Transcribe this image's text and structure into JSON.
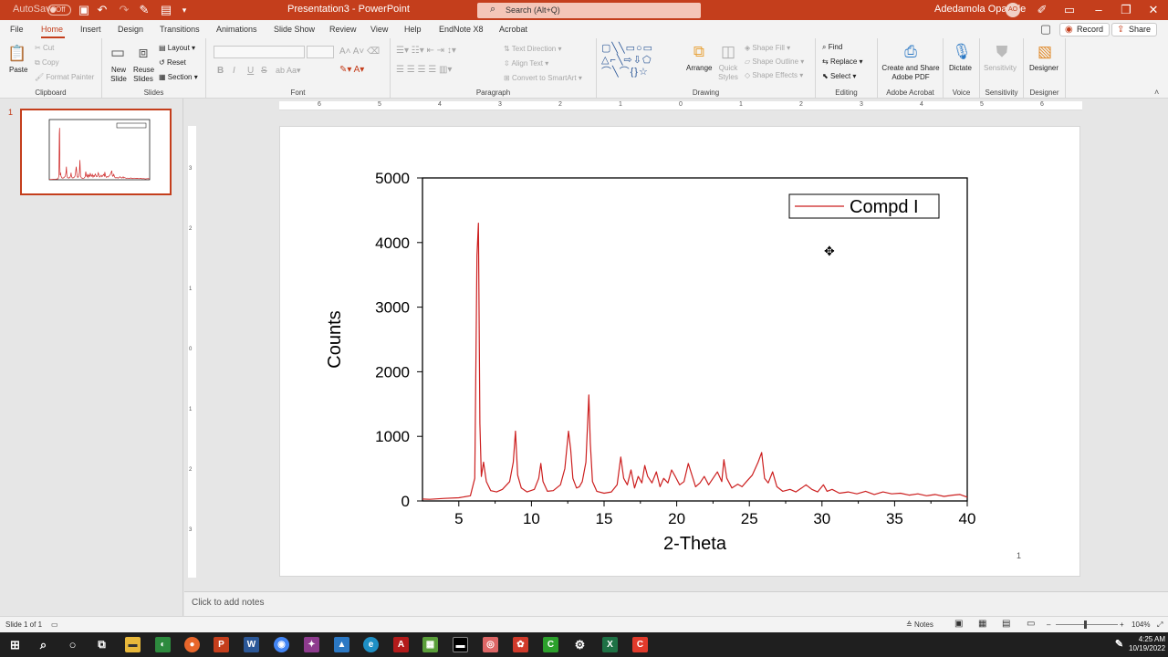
{
  "titlebar": {
    "autosave_label": "AutoSave",
    "autosave_state": "Off",
    "title": "Presentation3  -  PowerPoint",
    "search_placeholder": "Search (Alt+Q)",
    "user_name": "Adedamola Opalade",
    "user_initials": "AO"
  },
  "tabs": [
    "File",
    "Home",
    "Insert",
    "Design",
    "Transitions",
    "Animations",
    "Slide Show",
    "Review",
    "View",
    "Help",
    "EndNote X8",
    "Acrobat"
  ],
  "tab_right": {
    "record": "Record",
    "share": "Share"
  },
  "ribbon": {
    "clipboard": {
      "paste": "Paste",
      "cut": "Cut",
      "copy": "Copy",
      "format_painter": "Format Painter",
      "label": "Clipboard"
    },
    "slides": {
      "new_slide": "New Slide",
      "reuse_slides": "Reuse Slides",
      "layout": "Layout",
      "reset": "Reset",
      "section": "Section",
      "label": "Slides"
    },
    "font": {
      "label": "Font",
      "bold": "B",
      "italic": "I",
      "underline": "U",
      "strike": "S"
    },
    "paragraph": {
      "text_direction": "Text Direction",
      "align_text": "Align Text",
      "convert_smartart": "Convert to SmartArt",
      "label": "Paragraph"
    },
    "drawing": {
      "arrange": "Arrange",
      "quick_styles": "Quick Styles",
      "shape_fill": "Shape Fill",
      "shape_outline": "Shape Outline",
      "shape_effects": "Shape Effects",
      "label": "Drawing"
    },
    "editing": {
      "find": "Find",
      "replace": "Replace",
      "select": "Select",
      "label": "Editing"
    },
    "acrobat": {
      "create_share": "Create and Share Adobe PDF",
      "label": "Adobe Acrobat"
    },
    "voice": {
      "dictate": "Dictate",
      "label": "Voice"
    },
    "sensitivity": {
      "sensitivity": "Sensitivity",
      "label": "Sensitivity"
    },
    "designer": {
      "designer": "Designer",
      "label": "Designer"
    }
  },
  "thumbnail": {
    "number": "1"
  },
  "ruler": {
    "h_ticks": [
      "6",
      "5",
      "4",
      "3",
      "2",
      "1",
      "0",
      "1",
      "2",
      "3",
      "4",
      "5",
      "6"
    ],
    "v_ticks": [
      "3",
      "2",
      "1",
      "0",
      "1",
      "2",
      "3"
    ]
  },
  "slide": {
    "number": "1"
  },
  "notes": {
    "placeholder": "Click to add notes"
  },
  "status": {
    "slide_info": "Slide 1 of 1",
    "notes_btn": "Notes",
    "zoom": "104%"
  },
  "clock": {
    "time": "4:25 AM",
    "date": "10/19/2022"
  },
  "colors": {
    "accent": "#c43e1c",
    "series": "#cc1f1f"
  },
  "chart_data": {
    "type": "line",
    "xlabel": "2-Theta",
    "ylabel": "Counts",
    "xlim": [
      2.5,
      40
    ],
    "ylim": [
      0,
      5000
    ],
    "xticks": [
      5,
      10,
      15,
      20,
      25,
      30,
      35,
      40
    ],
    "yticks": [
      0,
      1000,
      2000,
      3000,
      4000,
      5000
    ],
    "legend": "top-right",
    "series": [
      {
        "name": "Compd I",
        "x": [
          2.5,
          3,
          4,
          5,
          5.8,
          6.1,
          6.25,
          6.35,
          6.45,
          6.55,
          6.7,
          6.9,
          7.2,
          7.6,
          8,
          8.5,
          8.75,
          8.9,
          9.05,
          9.3,
          9.7,
          10.2,
          10.5,
          10.65,
          10.8,
          11.1,
          11.5,
          12,
          12.3,
          12.55,
          12.7,
          12.85,
          13.1,
          13.3,
          13.5,
          13.75,
          13.95,
          14.05,
          14.2,
          14.5,
          15,
          15.5,
          15.9,
          16.15,
          16.35,
          16.6,
          16.85,
          17.1,
          17.35,
          17.6,
          17.8,
          18,
          18.3,
          18.6,
          18.85,
          19.1,
          19.4,
          19.65,
          19.9,
          20.2,
          20.5,
          20.8,
          21.05,
          21.3,
          21.6,
          21.9,
          22.2,
          22.5,
          22.8,
          23.1,
          23.25,
          23.45,
          23.8,
          24.2,
          24.5,
          24.8,
          25.2,
          25.6,
          25.85,
          26.05,
          26.3,
          26.6,
          26.9,
          27.3,
          27.8,
          28.2,
          28.6,
          28.9,
          29.3,
          29.7,
          30.1,
          30.35,
          30.7,
          31.2,
          31.8,
          32.4,
          33,
          33.6,
          34.2,
          34.8,
          35.4,
          36,
          36.6,
          37.2,
          37.8,
          38.4,
          39,
          39.5,
          40
        ],
        "y": [
          30,
          25,
          40,
          50,
          80,
          350,
          3800,
          4300,
          1200,
          380,
          600,
          300,
          160,
          140,
          180,
          300,
          600,
          1080,
          400,
          200,
          140,
          180,
          350,
          580,
          300,
          150,
          160,
          250,
          500,
          1080,
          800,
          350,
          200,
          220,
          300,
          600,
          1640,
          900,
          300,
          150,
          120,
          140,
          250,
          680,
          350,
          250,
          480,
          200,
          380,
          280,
          550,
          380,
          280,
          450,
          220,
          350,
          280,
          480,
          380,
          250,
          300,
          580,
          400,
          220,
          280,
          380,
          250,
          350,
          450,
          300,
          640,
          350,
          200,
          260,
          220,
          300,
          400,
          600,
          750,
          350,
          280,
          450,
          220,
          150,
          180,
          140,
          200,
          250,
          180,
          140,
          250,
          150,
          180,
          120,
          140,
          110,
          150,
          100,
          140,
          110,
          120,
          90,
          110,
          80,
          100,
          70,
          90,
          100,
          60
        ]
      }
    ]
  }
}
